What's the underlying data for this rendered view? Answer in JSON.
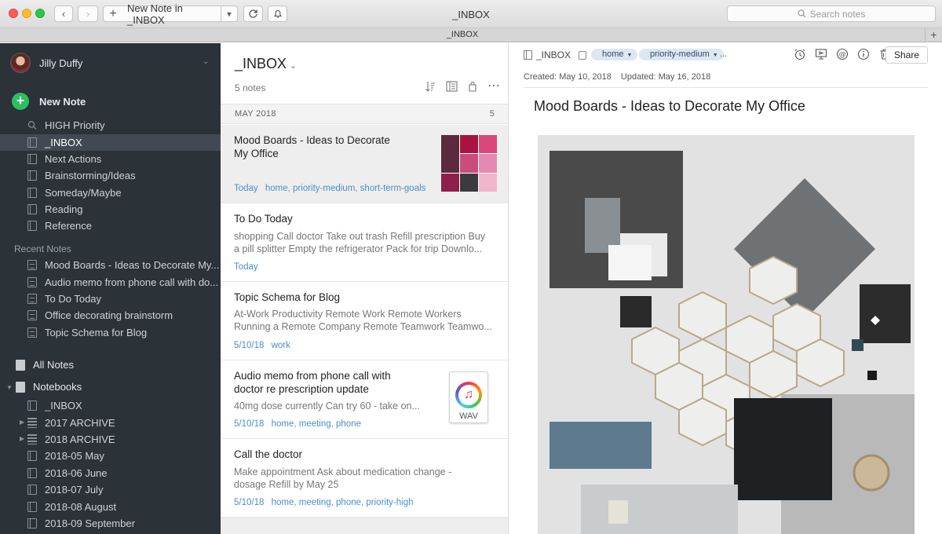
{
  "window": {
    "title": "_INBOX",
    "tab_title": "_INBOX"
  },
  "toolbar": {
    "new_note_label": "New Note in _INBOX",
    "search_placeholder": "Search notes"
  },
  "sidebar": {
    "user_name": "Jilly Duffy",
    "new_note": "New Note",
    "shortcuts": [
      {
        "label": "HIGH Priority",
        "icon": "search-icon"
      },
      {
        "label": "_INBOX",
        "icon": "notebook-icon",
        "active": true
      },
      {
        "label": "Next Actions",
        "icon": "notebook-icon"
      },
      {
        "label": "Brainstorming/Ideas",
        "icon": "notebook-icon"
      },
      {
        "label": "Someday/Maybe",
        "icon": "notebook-icon"
      },
      {
        "label": "Reading",
        "icon": "notebook-icon"
      },
      {
        "label": "Reference",
        "icon": "notebook-icon"
      }
    ],
    "recent_label": "Recent Notes",
    "recent": [
      "Mood Boards - Ideas to Decorate My...",
      "Audio memo from phone call with do...",
      "To Do Today",
      "Office decorating brainstorm",
      "Topic Schema for Blog"
    ],
    "all_notes": "All Notes",
    "notebooks_label": "Notebooks",
    "notebooks": [
      {
        "label": "_INBOX",
        "type": "notebook"
      },
      {
        "label": "2017 ARCHIVE",
        "type": "stack"
      },
      {
        "label": "2018 ARCHIVE",
        "type": "stack"
      },
      {
        "label": "2018-05 May",
        "type": "notebook"
      },
      {
        "label": "2018-06 June",
        "type": "notebook"
      },
      {
        "label": "2018-07 July",
        "type": "notebook"
      },
      {
        "label": "2018-08 August",
        "type": "notebook"
      },
      {
        "label": "2018-09 September",
        "type": "notebook"
      }
    ]
  },
  "notelist": {
    "title": "_INBOX",
    "count": "5 notes",
    "month_label": "MAY 2018",
    "month_count": "5",
    "notes": [
      {
        "title_line1": "Mood Boards - Ideas to Decorate",
        "title_line2": "My Office",
        "snippet_line1": "",
        "snippet_line2": "",
        "date": "Today",
        "tags": "home, priority-medium, short-term-goals"
      },
      {
        "title_line1": "To Do Today",
        "title_line2": "",
        "snippet_line1": "shopping Call doctor Take out trash Refill prescription Buy",
        "snippet_line2": "a pill splitter Empty the refrigerator Pack for trip Downlo...",
        "date": "Today",
        "tags": ""
      },
      {
        "title_line1": "Topic Schema for Blog",
        "title_line2": "",
        "snippet_line1": "At-Work Productivity Remote Work Remote Workers",
        "snippet_line2": "Running a Remote Company Remote Teamwork Teamwo...",
        "date": "5/10/18",
        "tags": "work"
      },
      {
        "title_line1": "Audio memo from phone call with",
        "title_line2": "doctor re prescription update",
        "snippet_line1": "40mg dose currently Can try 60 - take on...",
        "snippet_line2": "",
        "date": "5/10/18",
        "tags": "home, meeting, phone"
      },
      {
        "title_line1": "Call the doctor",
        "title_line2": "",
        "snippet_line1": "Make appointment Ask about medication change -",
        "snippet_line2": "dosage Refill by May 25",
        "date": "5/10/18",
        "tags": "home, meeting, phone, priority-high"
      }
    ],
    "wav_label": "WAV"
  },
  "editor": {
    "notebook": "_INBOX",
    "tags": [
      "home",
      "priority-medium"
    ],
    "more": "...",
    "share_label": "Share",
    "created": "Created: May 10, 2018",
    "updated": "Updated: May 16, 2018",
    "title": "Mood Boards - Ideas to Decorate My Office"
  },
  "colors": {
    "accent_green": "#2dbe60",
    "sidebar_bg": "#2b3238",
    "tag_blue": "#4a8ec8"
  }
}
